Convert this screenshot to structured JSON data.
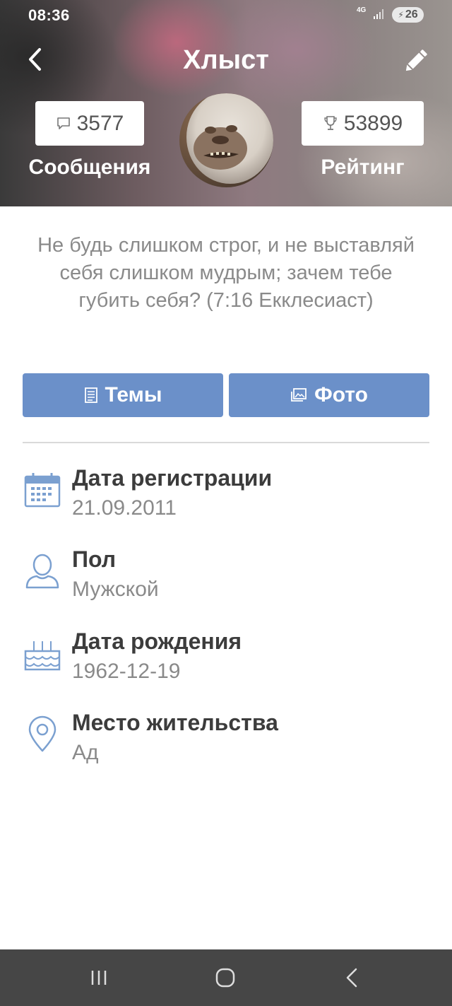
{
  "status_bar": {
    "time": "08:36",
    "network": "4G",
    "battery": "26",
    "battery_icon": "bolt-icon"
  },
  "header": {
    "title": "Хлыст",
    "back_icon": "chevron-left-icon",
    "edit_icon": "pencil-icon"
  },
  "stats": {
    "messages_count": "3577",
    "messages_label": "Сообщения",
    "messages_icon": "speech-bubble-icon",
    "rating_value": "53899",
    "rating_label": "Рейтинг",
    "rating_icon": "trophy-icon"
  },
  "profile": {
    "status_quote": "Не будь слишком строг, и не выставляй себя слишком мудрым; зачем тебе губить себя? (7:16 Екклесиаст)"
  },
  "actions": {
    "topics_label": "Темы",
    "topics_icon": "document-icon",
    "photos_label": "Фото",
    "photos_icon": "photos-icon"
  },
  "info": [
    {
      "label": "Дата регистрации",
      "value": "21.09.2011",
      "icon": "calendar-icon"
    },
    {
      "label": "Пол",
      "value": "Мужской",
      "icon": "user-icon"
    },
    {
      "label": "Дата рождения",
      "value": "1962-12-19",
      "icon": "birthday-cake-icon"
    },
    {
      "label": "Место жительства",
      "value": "Ад",
      "icon": "location-pin-icon"
    }
  ],
  "colors": {
    "accent": "#6b90c9",
    "icon_blue": "#7ba0d0",
    "nav_bar": "#464646"
  }
}
